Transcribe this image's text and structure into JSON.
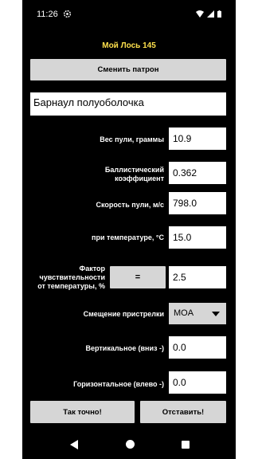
{
  "status_bar": {
    "time": "11:26"
  },
  "app_title": "Мой Лось 145",
  "change_cartridge_button": "Сменить патрон",
  "cartridge_name": "Барнаул полуоболочка",
  "fields": {
    "bullet_weight": {
      "label": "Вес пули, граммы",
      "value": "10.9"
    },
    "ballistic_coefficient": {
      "label_line1": "Баллистический",
      "label_line2": "коэффициент",
      "value": "0.362"
    },
    "bullet_speed": {
      "label": "Скорость пули, м/с",
      "value": "798.0"
    },
    "temperature": {
      "label": "при температуре, °C",
      "value": "15.0"
    },
    "temp_sensitivity": {
      "label_line1": "Фактор",
      "label_line2": "чувствительности",
      "label_line3": "от температуры, %",
      "button": "=",
      "value": "2.5"
    },
    "zero_offset": {
      "label": "Смещение пристрелки",
      "selected": "MOA"
    },
    "vertical": {
      "label": "Вертикальное (вниз -)",
      "value": "0.0"
    },
    "horizontal": {
      "label": "Горизонтальное (влево -)",
      "value": "0.0"
    }
  },
  "buttons": {
    "ok": "Так точно!",
    "cancel": "Отставить!"
  },
  "icons": [
    "gear-icon",
    "wifi-icon",
    "signal-icon",
    "battery-icon",
    "nav-back-icon",
    "nav-home-icon",
    "nav-recents-icon"
  ]
}
